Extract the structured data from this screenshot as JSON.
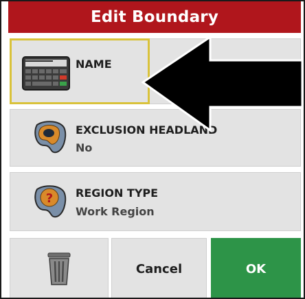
{
  "dialog": {
    "title": "Edit Boundary"
  },
  "fields": [
    {
      "label": "NAME",
      "value": "",
      "icon": "keyboard-icon"
    },
    {
      "label": "EXCLUSION HEADLAND",
      "value": "No",
      "icon": "exclusion-headland-icon"
    },
    {
      "label": "REGION TYPE",
      "value": "Work Region",
      "icon": "region-type-icon"
    }
  ],
  "buttons": {
    "delete_icon": "trash-icon",
    "cancel_label": "Cancel",
    "ok_label": "OK"
  },
  "colors": {
    "title_bar": "#b0161c",
    "ok_button": "#2d9448",
    "highlight": "#d9c23a",
    "row_background": "#e3e3e3"
  }
}
